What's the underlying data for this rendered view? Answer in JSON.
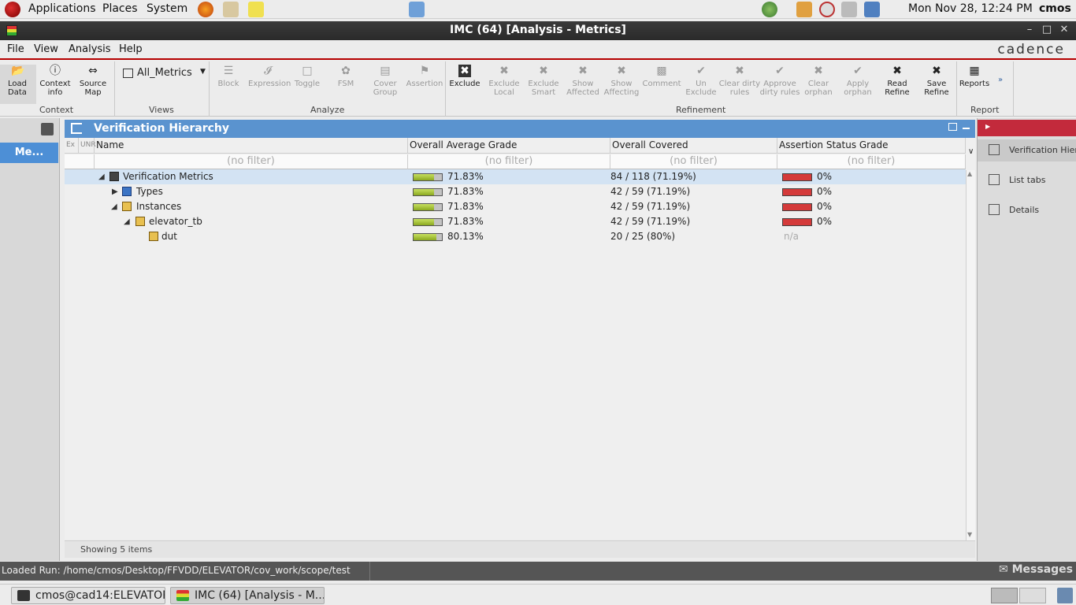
{
  "top_panel": {
    "applications": "Applications",
    "places": "Places",
    "system": "System",
    "clock": "Mon Nov 28, 12:24 PM",
    "user": "cmos"
  },
  "window": {
    "title": "IMC (64) [Analysis - Metrics]"
  },
  "menubar": {
    "items": [
      "File",
      "View",
      "Analysis",
      "Help"
    ],
    "brand": "cadence"
  },
  "ribbon": {
    "context": {
      "label": "Context",
      "buttons": [
        {
          "label1": "Load",
          "label2": "Data",
          "icon": "folder-open-icon",
          "enabled": true
        },
        {
          "label1": "Context",
          "label2": "info",
          "icon": "info-icon",
          "enabled": true
        },
        {
          "label1": "Source",
          "label2": "Map",
          "icon": "source-map-icon",
          "enabled": true
        }
      ]
    },
    "views": {
      "label": "Views",
      "selected": "All_Metrics"
    },
    "analyze": {
      "label": "Analyze",
      "buttons": [
        {
          "label1": "Block",
          "label2": "",
          "icon": "block-icon"
        },
        {
          "label1": "Expression",
          "label2": "",
          "icon": "expression-icon"
        },
        {
          "label1": "Toggle",
          "label2": "",
          "icon": "toggle-icon"
        },
        {
          "label1": "FSM",
          "label2": "",
          "icon": "fsm-icon"
        },
        {
          "label1": "Cover",
          "label2": "Group",
          "icon": "cover-group-icon"
        },
        {
          "label1": "Assertion",
          "label2": "",
          "icon": "flag-icon"
        }
      ]
    },
    "refinement": {
      "label": "Refinement",
      "buttons": [
        {
          "label1": "Exclude",
          "label2": "",
          "icon": "exclude-icon",
          "enabled": true
        },
        {
          "label1": "Exclude",
          "label2": "Local",
          "icon": "exclude-local-icon",
          "enabled": false
        },
        {
          "label1": "Exclude",
          "label2": "Smart",
          "icon": "exclude-smart-icon",
          "enabled": false
        },
        {
          "label1": "Show",
          "label2": "Affected",
          "icon": "show-affected-icon",
          "enabled": false
        },
        {
          "label1": "Show",
          "label2": "Affecting",
          "icon": "show-affecting-icon",
          "enabled": false
        },
        {
          "label1": "Comment",
          "label2": "",
          "icon": "comment-icon",
          "enabled": false
        },
        {
          "label1": "Un",
          "label2": "Exclude",
          "icon": "checkmark-icon",
          "enabled": false
        },
        {
          "label1": "Clear dirty",
          "label2": "rules",
          "icon": "clear-dirty-icon",
          "enabled": false
        },
        {
          "label1": "Approve",
          "label2": "dirty rules",
          "icon": "approve-dirty-icon",
          "enabled": false
        },
        {
          "label1": "Clear",
          "label2": "orphan",
          "icon": "clear-orphan-icon",
          "enabled": false
        },
        {
          "label1": "Apply",
          "label2": "orphan",
          "icon": "apply-orphan-icon",
          "enabled": false
        },
        {
          "label1": "Read",
          "label2": "Refine",
          "icon": "read-refine-icon",
          "enabled": true
        },
        {
          "label1": "Save",
          "label2": "Refine",
          "icon": "save-refine-icon",
          "enabled": true
        }
      ]
    },
    "report": {
      "label": "Report",
      "button": "Reports"
    }
  },
  "left_strip": {
    "tab": "Me..."
  },
  "panel": {
    "title": "Verification Hierarchy",
    "columns": {
      "ex": "Ex",
      "unr": "UNR",
      "name": "Name",
      "grade": "Overall Average Grade",
      "covered": "Overall Covered",
      "assertion": "Assertion Status Grade"
    },
    "filter_text": "(no filter)",
    "rows": [
      {
        "name": "Verification Metrics",
        "grade": "71.83%",
        "grade_value": 71.83,
        "covered": "84 / 118 (71.19%)",
        "assertion": "0%"
      },
      {
        "name": "Types",
        "grade": "71.83%",
        "grade_value": 71.83,
        "covered": "42 / 59 (71.19%)",
        "assertion": "0%"
      },
      {
        "name": "Instances",
        "grade": "71.83%",
        "grade_value": 71.83,
        "covered": "42 / 59 (71.19%)",
        "assertion": "0%"
      },
      {
        "name": "elevator_tb",
        "grade": "71.83%",
        "grade_value": 71.83,
        "covered": "42 / 59 (71.19%)",
        "assertion": "0%"
      },
      {
        "name": "dut",
        "grade": "80.13%",
        "grade_value": 80.13,
        "covered": "20 / 25 (80%)",
        "assertion": "n/a"
      }
    ],
    "footer": "Showing 5 items"
  },
  "right_panel": {
    "items": [
      "Verification Hier...",
      "List tabs",
      "Details"
    ]
  },
  "statusbar": {
    "text": "Loaded Run: /home/cmos/Desktop/FFVDD/ELEVATOR/cov_work/scope/test",
    "messages": "Messages"
  },
  "taskbar": {
    "tasks": [
      "cmos@cad14:ELEVATOR",
      "IMC (64) [Analysis - M..."
    ]
  }
}
